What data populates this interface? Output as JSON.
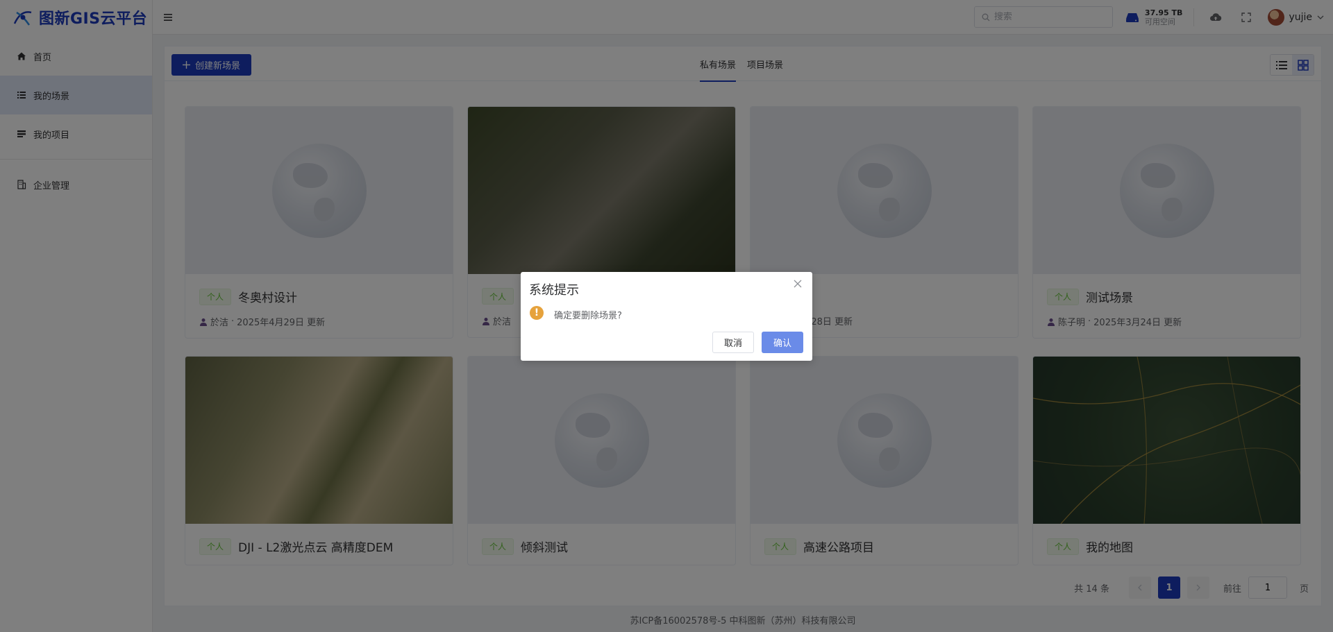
{
  "app": {
    "brand": "图新GIS云平台"
  },
  "sidebar": {
    "items": [
      {
        "label": "首页",
        "icon": "home-icon"
      },
      {
        "label": "我的场景",
        "icon": "list-icon",
        "active": true
      },
      {
        "label": "我的项目",
        "icon": "project-icon"
      },
      {
        "label": "企业管理",
        "icon": "building-icon"
      }
    ]
  },
  "header": {
    "search_placeholder": "搜索",
    "storage_amount": "37.95 TB",
    "storage_label": "可用空间",
    "username": "yujie"
  },
  "toolbar": {
    "create_label": "创建新场景",
    "tabs": [
      {
        "label": "私有场景",
        "active": true
      },
      {
        "label": "项目场景"
      }
    ]
  },
  "cards": [
    {
      "badge": "个人",
      "title": "冬奥村设计",
      "author": "於洁",
      "updated": "2025年4月29日 更新",
      "thumb": "globe"
    },
    {
      "badge": "个人",
      "title": "",
      "author": "於洁",
      "updated": "",
      "thumb": "aerial"
    },
    {
      "badge": "个人",
      "title": "",
      "author": "",
      "updated": "2025年3月28日 更新",
      "thumb": "globe"
    },
    {
      "badge": "个人",
      "title": "测试场景",
      "author": "陈子明",
      "updated": "2025年3月24日 更新",
      "thumb": "globe"
    },
    {
      "badge": "个人",
      "title": "DJI - L2激光点云 高精度DEM",
      "thumb": "dem"
    },
    {
      "badge": "个人",
      "title": "倾斜测试",
      "thumb": "globe"
    },
    {
      "badge": "个人",
      "title": "高速公路项目",
      "thumb": "globe"
    },
    {
      "badge": "个人",
      "title": "我的地图",
      "thumb": "map"
    }
  ],
  "pagination": {
    "total": "共 14 条",
    "current": "1",
    "goto_label": "前往",
    "goto_value": "1",
    "page_unit": "页"
  },
  "footer": {
    "text": "苏ICP备16002578号-5 中科图新（苏州）科技有限公司"
  },
  "dialog": {
    "title": "系统提示",
    "message": "确定要删除场景?",
    "cancel_label": "取消",
    "confirm_label": "确认"
  },
  "colors": {
    "primary": "#1d3bbd",
    "warning": "#e6a23c",
    "badge": "#67c23a"
  }
}
